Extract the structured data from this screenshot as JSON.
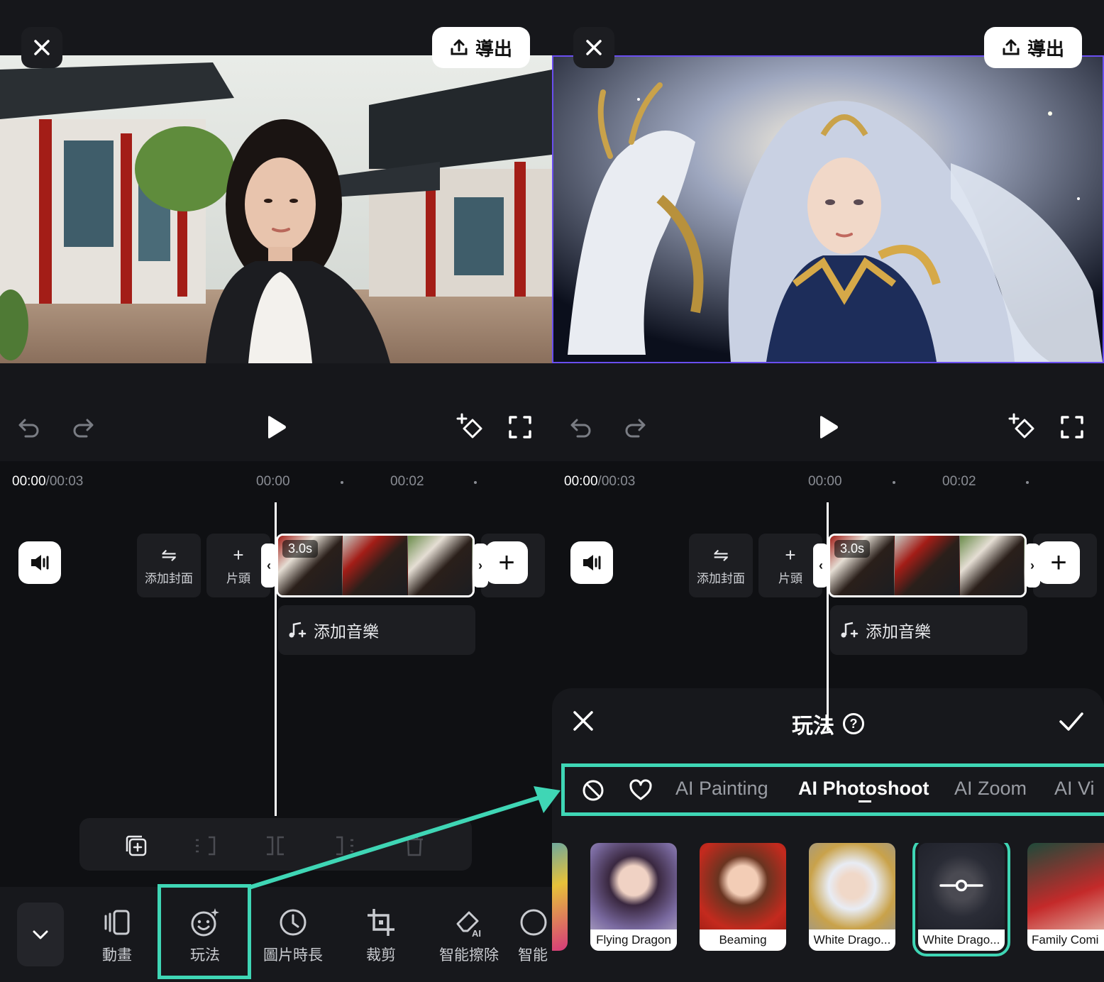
{
  "panels": {
    "left": {
      "export_label": "導出",
      "time_current": "00:00",
      "time_total": "/00:03",
      "ruler": [
        "00:00",
        "00:02"
      ],
      "clip_duration": "3.0s",
      "add_cover_label": "添加封面",
      "intro_label": "片頭",
      "add_music_label": "添加音樂",
      "bottom_tools": [
        {
          "label": "動畫",
          "icon": "animation-icon"
        },
        {
          "label": "玩法",
          "icon": "smile-sparkle-icon"
        },
        {
          "label": "圖片時長",
          "icon": "clock-icon"
        },
        {
          "label": "裁剪",
          "icon": "crop-icon"
        },
        {
          "label": "智能擦除",
          "icon": "ai-eraser-icon"
        },
        {
          "label": "智能",
          "icon": "ai-icon"
        }
      ]
    },
    "right": {
      "export_label": "導出",
      "time_current": "00:00",
      "time_total": "/00:03",
      "ruler": [
        "00:00",
        "00:02"
      ],
      "clip_duration": "3.0s",
      "add_cover_label": "添加封面",
      "intro_label": "片頭",
      "add_music_label": "添加音樂",
      "sheet": {
        "title": "玩法",
        "tabs": [
          "AI Painting",
          "AI Photoshoot",
          "AI Zoom",
          "AI Vi"
        ],
        "active_tab": "AI Photoshoot",
        "effects": [
          "Flying Dragon",
          "Beaming",
          "White Drago...",
          "White Drago...",
          "Family Comi"
        ],
        "selected_effect_index": 3
      }
    }
  },
  "colors": {
    "accent": "#3fd6b5",
    "selection": "#6a4ef0",
    "background": "#121316"
  }
}
